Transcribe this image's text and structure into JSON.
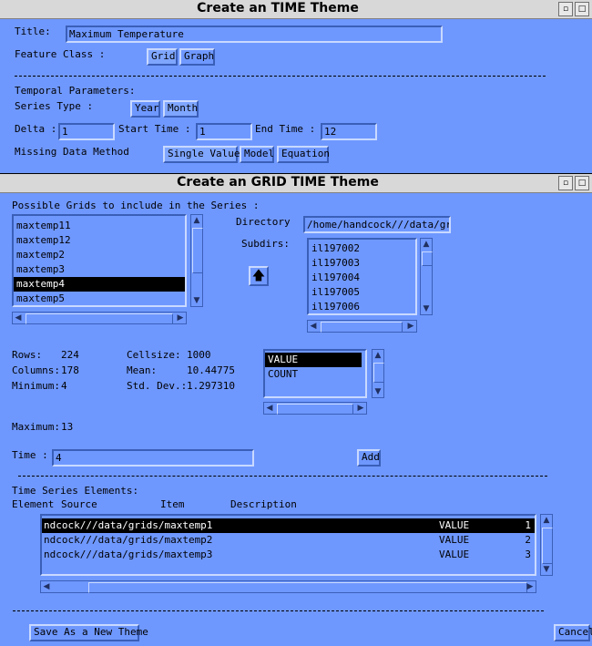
{
  "top_window": {
    "title": "Create an TIME Theme",
    "title_label": "Title:",
    "title_value": "Maximum Temperature",
    "feature_class_label": "Feature Class :",
    "feature_class_options": [
      "Grid",
      "Graph"
    ],
    "temporal_label": "Temporal Parameters:",
    "series_type_label": "Series Type :",
    "series_type_options": [
      "Year",
      "Month"
    ],
    "delta_label": "Delta :",
    "delta_value": "1",
    "start_time_label": "Start Time :",
    "start_time_value": "1",
    "end_time_label": "End Time :",
    "end_time_value": "12",
    "missing_label": "Missing Data Method",
    "missing_options": [
      "Single Value",
      "Model",
      "Equation"
    ]
  },
  "grid_window": {
    "title": "Create an GRID TIME Theme",
    "possible_grids_label": "Possible Grids to include in the Series :",
    "grids": [
      "maxtemp11",
      "maxtemp12",
      "maxtemp2",
      "maxtemp3",
      "maxtemp4",
      "maxtemp5"
    ],
    "selected_grid_index": 4,
    "directory_label": "Directory",
    "directory_value": "/home/handcock///data/grid",
    "subdirs_label": "Subdirs:",
    "subdirs": [
      "il197002",
      "il197003",
      "il197004",
      "il197005",
      "il197006"
    ],
    "up_arrow": "🡅",
    "stats": {
      "rows_label": "Rows:",
      "rows_value": "224",
      "columns_label": "Columns:",
      "columns_value": "178",
      "minimum_label": "Minimum:",
      "minimum_value": "4",
      "cellsize_label": "Cellsize:",
      "cellsize_value": "1000",
      "mean_label": "Mean:",
      "mean_value": "10.44775",
      "stddev_label": "Std. Dev.:",
      "stddev_value": "1.297310",
      "maximum_label": "Maximum:",
      "maximum_value": "13"
    },
    "items": [
      "VALUE",
      "COUNT"
    ],
    "time_label": "Time :",
    "time_value": "4",
    "add_label": "Add",
    "elements_label": "Time Series Elements:",
    "col_element": "Element",
    "col_source": "Source",
    "col_item": "Item",
    "col_description": "Description",
    "elements": [
      {
        "source": "ndcock///data/grids/maxtemp1",
        "item": "VALUE",
        "element": "1"
      },
      {
        "source": "ndcock///data/grids/maxtemp2",
        "item": "VALUE",
        "element": "2"
      },
      {
        "source": "ndcock///data/grids/maxtemp3",
        "item": "VALUE",
        "element": "3"
      }
    ],
    "save_label": "Save As a New Theme",
    "cancel_label": "Cancel"
  }
}
